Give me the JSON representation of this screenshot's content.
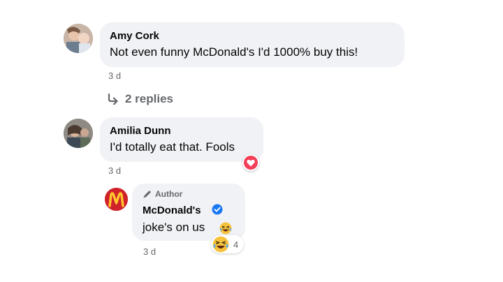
{
  "comments": [
    {
      "author": "Amy Cork",
      "text": "Not even funny McDonald's I'd 1000% buy this!",
      "time": "3 d",
      "replies_label": "2 replies"
    },
    {
      "author": "Amilia Dunn",
      "text": "I'd totally eat that. Fools",
      "time": "3 d",
      "reaction": "heart-icon"
    }
  ],
  "reply": {
    "badge": "Author",
    "author": "McDonald's",
    "text": "joke's on us",
    "time": "3 d",
    "reaction_count": "4",
    "reaction": "laughing-crying-emoji",
    "verified": true
  },
  "colors": {
    "bubble": "#f0f2f5",
    "secondary_text": "#65676b",
    "verified_blue": "#1877f2",
    "heart_red": "#f33e58",
    "mcdonalds_red": "#d0222b",
    "mcdonalds_yellow": "#ffc72c"
  }
}
